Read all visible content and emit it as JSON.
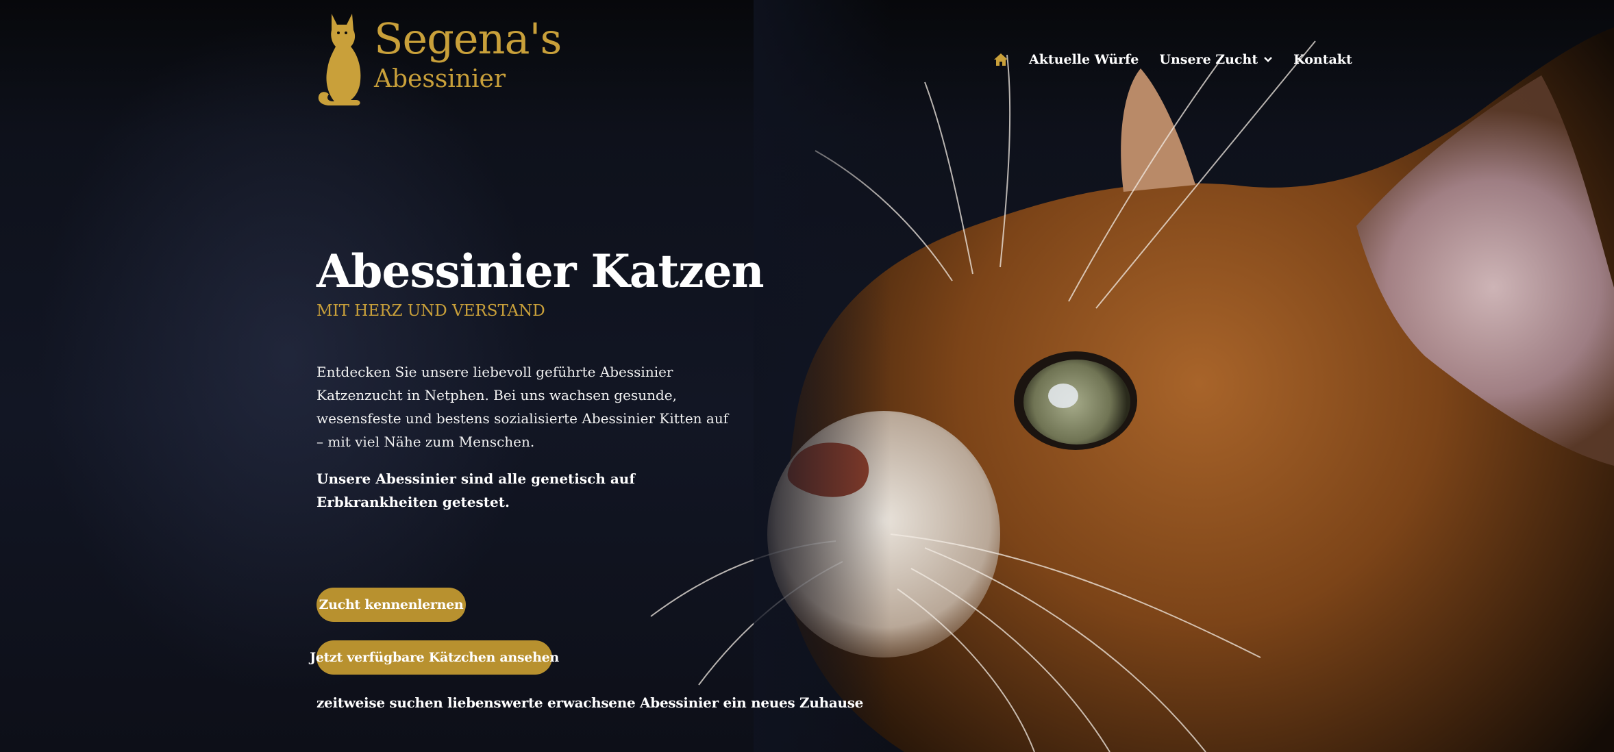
{
  "site": {
    "logo_name": "Segena's",
    "logo_sub": "Abessinier",
    "brand_color": "#c9a03a"
  },
  "nav": {
    "home_icon": "home-icon",
    "items": [
      {
        "label": "Aktuelle Würfe"
      },
      {
        "label": "Unsere Zucht",
        "has_dropdown": true
      },
      {
        "label": "Kontakt"
      }
    ]
  },
  "hero": {
    "title": "Abessinier Katzen",
    "subtitle": "MIT HERZ UND VERSTAND",
    "text": "Entdecken Sie unsere liebevoll geführte Abessinier Katzenzucht in Netphen. Bei uns wachsen gesunde, wesensfeste und bestens sozialisierte Abessinier Kitten auf – mit viel Nähe zum Menschen.",
    "bold_text": "Unsere Abessinier sind alle genetisch auf Erbkrankheiten getestet.",
    "button_primary": "Zucht kennenlernen",
    "button_secondary": "Jetzt verfügbare Kätzchen ansehen",
    "footnote": "zeitweise suchen liebenswerte erwachsene Abessinier ein neues Zuhause"
  },
  "colors": {
    "button_bg": "#b8912f",
    "background": "#0f1320"
  }
}
